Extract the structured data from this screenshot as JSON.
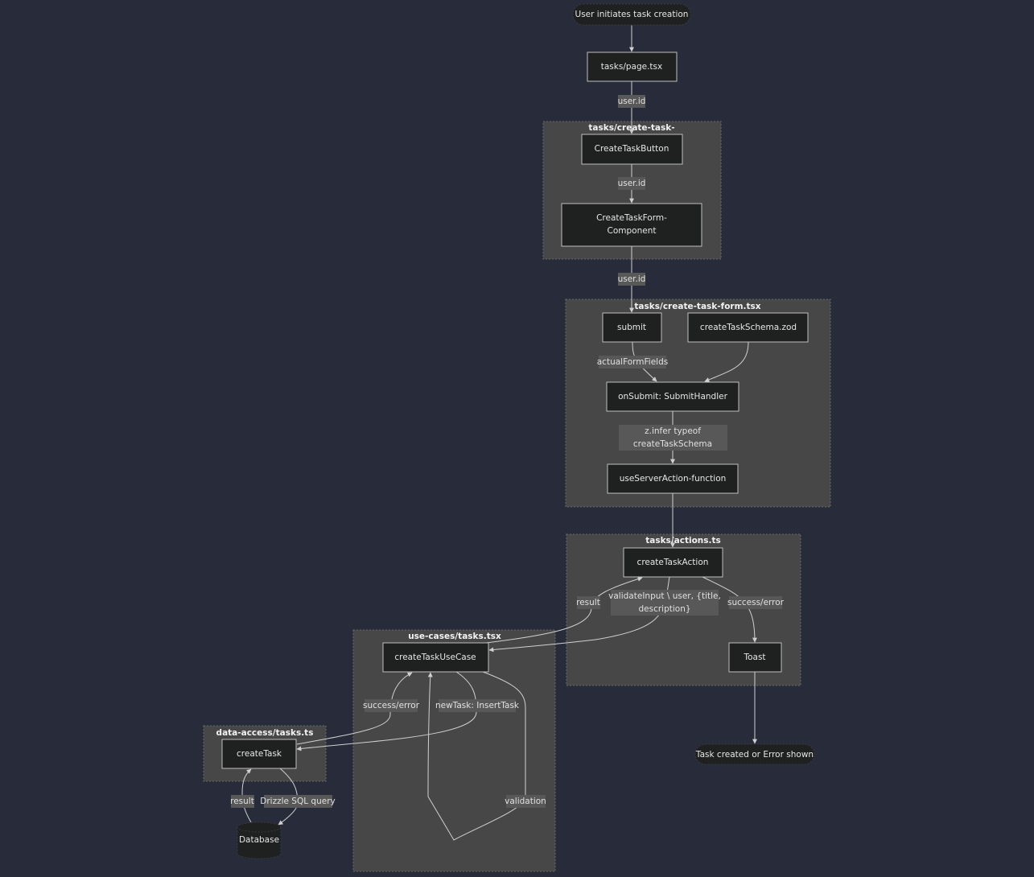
{
  "colors": {
    "background": "#282c3a",
    "cluster": "#474747",
    "node": "#1f2020",
    "edge_label": "#585858",
    "line": "#d0d0d0"
  },
  "clusters": {
    "create_task_button": "tasks/create-task-",
    "create_task_form": "tasks/create-task-form.tsx",
    "actions": "tasks/actions.ts",
    "use_cases": "use-cases/tasks.tsx",
    "data_access": "data-access/tasks.ts"
  },
  "nodes": {
    "start": "User initiates task creation",
    "page": "tasks/page.tsx",
    "create_task_button": "CreateTaskButton",
    "create_task_form_component": [
      "CreateTaskForm-",
      "Component"
    ],
    "submit": "submit",
    "schema": "createTaskSchema.zod",
    "on_submit": "onSubmit: SubmitHandler",
    "use_server_action": "useServerAction-function",
    "create_task_action": "createTaskAction",
    "toast": "Toast",
    "end": "Task created or Error shown",
    "create_task_use_case": "createTaskUseCase",
    "create_task": "createTask",
    "database": "Database"
  },
  "edge_labels": {
    "user_id_1": "user.id",
    "user_id_2": "user.id",
    "user_id_3": "user.id",
    "actual_form_fields": "actualFormFields",
    "z_infer": [
      "z.infer typeof",
      "createTaskSchema"
    ],
    "result_action": "result",
    "validate_input": [
      "validateInput \\ user, {title,",
      "description}"
    ],
    "success_error_toast": "success/error",
    "success_error_usecase": "success/error",
    "new_task": "newTask: InsertTask",
    "validation": "validation",
    "result_db": "result",
    "drizzle": "Drizzle SQL query"
  }
}
